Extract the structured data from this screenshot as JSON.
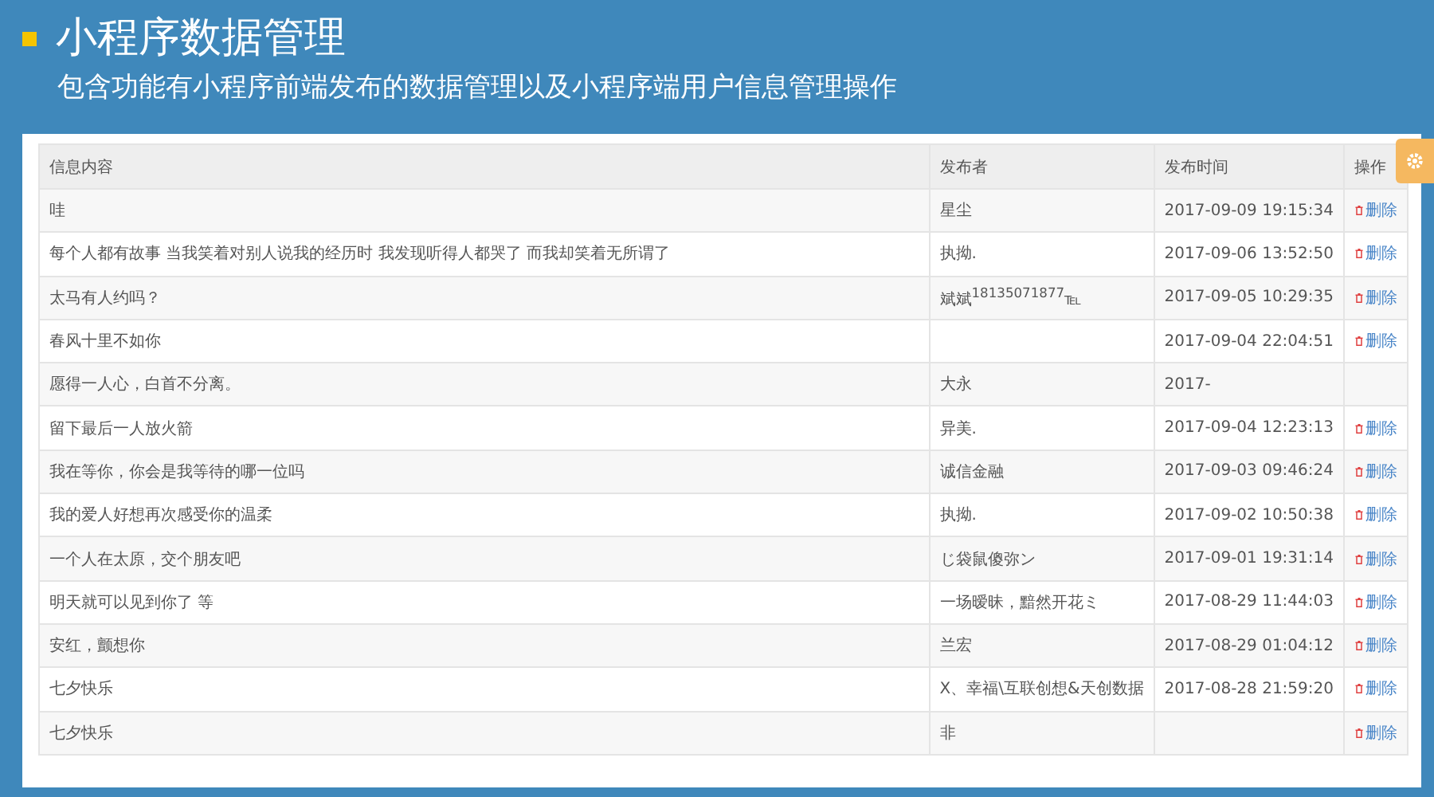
{
  "header": {
    "title": "小程序数据管理",
    "subtitle": "包含功能有小程序前端发布的数据管理以及小程序端用户信息管理操作"
  },
  "table": {
    "columns": [
      "信息内容",
      "发布者",
      "发布时间",
      "操作"
    ],
    "rows": [
      {
        "content": "哇",
        "publisher": "星尘",
        "time": "2017-09-09 19:15:34",
        "action": "删除"
      },
      {
        "content": "每个人都有故事 当我笑着对别人说我的经历时 我发现听得人都哭了 而我却笑着无所谓了",
        "publisher": "执拗.",
        "time": "2017-09-06 13:52:50",
        "action": "删除"
      },
      {
        "content": "太马有人约吗？",
        "publisher": "斌斌$^{18135071877}$℡",
        "time": "2017-09-05 10:29:35",
        "action": "删除"
      },
      {
        "content": "春风十里不如你",
        "publisher": "",
        "time": "2017-09-04 22:04:51",
        "action": "删除"
      },
      {
        "content": "愿得一人心，白首不分离。",
        "publisher": "大永",
        "time": "2017-"
      },
      {
        "content": "留下最后一人放火箭",
        "publisher": "异美.",
        "time": "2017-09-04 12:23:13",
        "action": "删除"
      },
      {
        "content": "我在等你，你会是我等待的哪一位吗",
        "publisher": "诚信金融",
        "time": "2017-09-03 09:46:24",
        "action": "删除"
      },
      {
        "content": "我的爱人好想再次感受你的温柔",
        "publisher": "执拗.",
        "time": "2017-09-02 10:50:38",
        "action": "删除"
      },
      {
        "content": "一个人在太原，交个朋友吧",
        "publisher": "じ袋鼠傻弥ン",
        "time": "2017-09-01 19:31:14",
        "action": "删除"
      },
      {
        "content": "明天就可以见到你了 等",
        "publisher": "一场暧昧，黯然开花ミ",
        "time": "2017-08-29 11:44:03",
        "action": "删除"
      },
      {
        "content": "安红，颤想你",
        "publisher": "兰宏",
        "time": "2017-08-29 01:04:12",
        "action": "删除"
      },
      {
        "content": "七夕快乐",
        "publisher": "X、幸福\\互联创想&天创数据",
        "time": "2017-08-28 21:59:20",
        "action": "删除"
      },
      {
        "content": "七夕快乐",
        "publisher": "非",
        "action": "删除"
      }
    ]
  }
}
